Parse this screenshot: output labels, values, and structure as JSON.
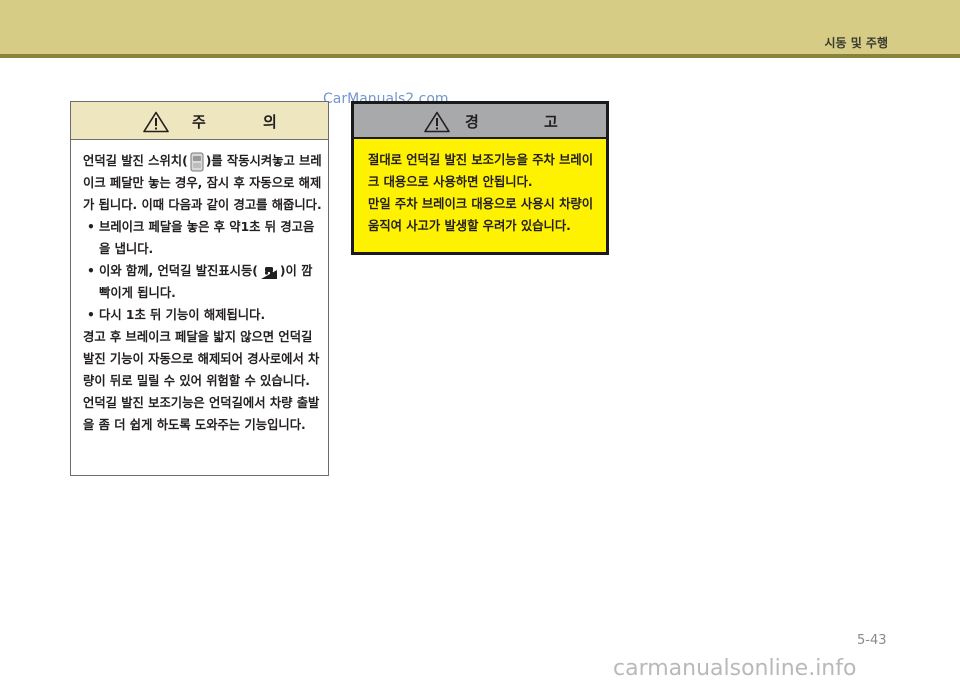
{
  "header": {
    "section_title": "시동 및 주행"
  },
  "watermark_top": "CarManuals2.com",
  "caution": {
    "title": "주 의",
    "icon": "warning-triangle-icon",
    "body": {
      "intro_before_icon": "언덕길 발진 스위치(",
      "intro_switch_icon": "hill-start-switch-icon",
      "intro_after_icon": ")를 작동시켜놓고 브레이크 페달만 놓는 경우, 잠시 후 자동으로 해제가 됩니다. 이때 다음과 같이 경고를 해줍니다.",
      "bullet_1": "브레이크 페달을 놓은 후 약1초 뒤 경고음을 냅니다.",
      "bullet_2_before_icon": "이와 함께, 언덕길 발진표시등(",
      "bullet_2_icon": "hill-start-indicator-icon",
      "bullet_2_after_icon": ")이 깜빡이게 됩니다.",
      "bullet_3": "다시 1초 뒤 기능이 해제됩니다.",
      "paragraph_2": "경고 후 브레이크 페달을 밟지 않으면 언덕길 발진 기능이 자동으로 해제되어 경사로에서 차량이 뒤로 밀릴 수 있어 위험할 수 있습니다.",
      "paragraph_3": "언덕길 발진 보조기능은 언덕길에서 차량 출발을 좀 더 쉽게 하도록 도와주는 기능입니다."
    }
  },
  "warning": {
    "title": "경 고",
    "icon": "warning-triangle-icon",
    "body_1": "절대로 언덕길 발진 보조기능을 주차 브레이크 대용으로 사용하면 안됩니다.",
    "body_2": "만일 주차 브레이크 대용으로 사용시 차량이 움직여 사고가 발생할 우려가 있습니다."
  },
  "page_number": "5-43",
  "watermark_bottom": "carmanualsonline.info",
  "colors": {
    "header_bar": "#d6cc85",
    "header_line": "#8a8238",
    "caution_head": "#eee6be",
    "warning_head": "#a8a9ab",
    "warning_bg": "#fff200"
  }
}
